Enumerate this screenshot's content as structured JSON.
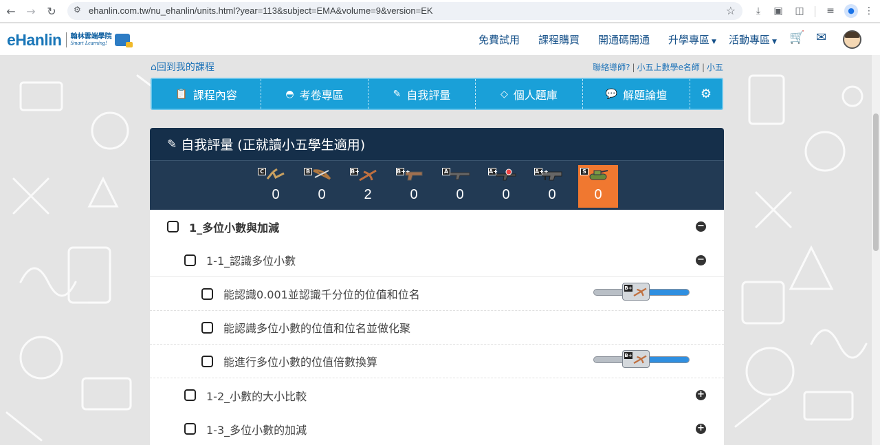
{
  "browser": {
    "url": "ehanlin.com.tw/nu_ehanlin/units.html?year=113&subject=EMA&volume=9&version=EK"
  },
  "header": {
    "logo_text": "eHanlin",
    "logo_sub_cn": "翰林雲端學院",
    "logo_sub_en": "Smart Learning!",
    "nav": [
      {
        "label": "免費試用"
      },
      {
        "label": "課程購買"
      },
      {
        "label": "開通碼開通"
      },
      {
        "label": "升學專區"
      },
      {
        "label": "活動專區"
      }
    ]
  },
  "page": {
    "back_link": "回到我的課程",
    "teacher_links": [
      "聯絡導師",
      "小五上數學e名師",
      "小五"
    ]
  },
  "tabs": [
    {
      "label": "課程內容",
      "icon": "clipboard-icon"
    },
    {
      "label": "考卷專區",
      "icon": "mask-icon"
    },
    {
      "label": "自我評量",
      "icon": "edit-icon"
    },
    {
      "label": "個人題庫",
      "icon": "diamond-icon"
    },
    {
      "label": "解題論壇",
      "icon": "chat-icon"
    }
  ],
  "panel": {
    "title": "自我評量 (正就讀小五學生適用)",
    "badges": [
      {
        "tag": "C",
        "weapon": "slingshot-icon",
        "count": "0",
        "active": false
      },
      {
        "tag": "B",
        "weapon": "bow-icon",
        "count": "0",
        "active": false
      },
      {
        "tag": "B+",
        "weapon": "crossbow-icon",
        "count": "2",
        "active": false
      },
      {
        "tag": "B++",
        "weapon": "pistol-icon",
        "count": "0",
        "active": false
      },
      {
        "tag": "A",
        "weapon": "rifle-icon",
        "count": "0",
        "active": false
      },
      {
        "tag": "A+",
        "weapon": "sniper-icon",
        "count": "0",
        "active": false
      },
      {
        "tag": "A++",
        "weapon": "machinegun-icon",
        "count": "0",
        "active": false
      },
      {
        "tag": "S",
        "weapon": "tank-icon",
        "count": "0",
        "active": true
      }
    ],
    "tree": [
      {
        "label": "1_多位小數與加減",
        "level": 0,
        "toggle": "−"
      },
      {
        "label": "1-1_認識多位小數",
        "level": 1,
        "toggle": "−"
      },
      {
        "label": "能認識0.001並認識千分位的位值和位名",
        "level": 2,
        "progress": 0.4
      },
      {
        "label": "能認識多位小數的位值和位名並做化聚",
        "level": 2
      },
      {
        "label": "能進行多位小數的位值倍數換算",
        "level": 2,
        "progress": 0.4
      },
      {
        "label": "1-2_小數的大小比較",
        "level": 1,
        "toggle": "+"
      },
      {
        "label": "1-3_多位小數的加減",
        "level": 1,
        "toggle": "+"
      }
    ]
  },
  "colors": {
    "tab_blue": "#1aa0d8",
    "panel_dark": "#152f4a",
    "badge_bar": "#223a54",
    "active_badge": "#f07830",
    "link_blue": "#1e73b8"
  }
}
